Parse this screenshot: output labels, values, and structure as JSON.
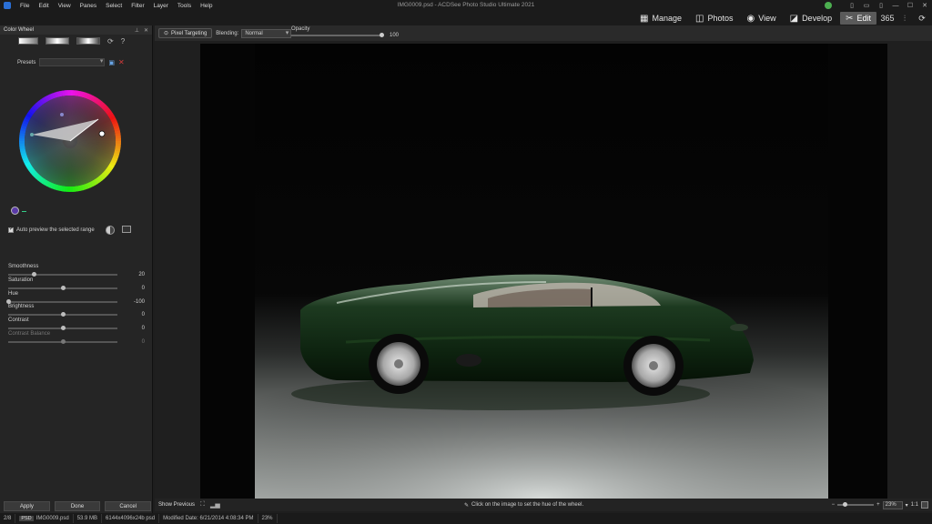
{
  "app": {
    "title": "IMG0009.psd - ACDSee Photo Studio Ultimate 2021",
    "menu": [
      "File",
      "Edit",
      "View",
      "Panes",
      "Select",
      "Filter",
      "Layer",
      "Tools",
      "Help"
    ]
  },
  "modes": [
    {
      "label": "Manage",
      "icon": "grid-icon"
    },
    {
      "label": "Photos",
      "icon": "photos-icon"
    },
    {
      "label": "View",
      "icon": "eye-icon"
    },
    {
      "label": "Develop",
      "icon": "develop-icon"
    },
    {
      "label": "Edit",
      "icon": "edit-icon",
      "active": true
    }
  ],
  "mode_extra_icons": [
    "365",
    "⫶",
    "⟳"
  ],
  "panel": {
    "title": "Color Wheel",
    "presets_label": "Presets",
    "auto_preview_label": "Auto preview the selected range",
    "sliders": [
      {
        "label": "Smoothness",
        "value": "20",
        "pos": 0.23,
        "disabled": false
      },
      {
        "label": "Saturation",
        "value": "0",
        "pos": 0.5,
        "disabled": false
      },
      {
        "label": "Hue",
        "value": "-100",
        "pos": 0.0,
        "disabled": false
      },
      {
        "label": "Brightness",
        "value": "0",
        "pos": 0.5,
        "disabled": false
      },
      {
        "label": "Contrast",
        "value": "0",
        "pos": 0.5,
        "disabled": false
      },
      {
        "label": "Contrast Balance",
        "value": "0",
        "pos": 0.5,
        "disabled": true
      }
    ],
    "buttons": {
      "apply": "Apply",
      "done": "Done",
      "cancel": "Cancel"
    }
  },
  "toolbar": {
    "pixel_targeting": "Pixel Targeting",
    "blending_label": "Blending:",
    "blending_value": "Normal",
    "opacity_label": "Opacity",
    "opacity_value": "100"
  },
  "footer": {
    "show_previous": "Show Previous",
    "hint": "Click on the image to set the hue of the wheel.",
    "zoom": "23%",
    "ratio": "1:1"
  },
  "status": {
    "index": "2/8",
    "format": "PSD",
    "filename": "IMG0009.psd",
    "size": "53.9 MB",
    "dimensions": "6144x4096x24b psd",
    "modified": "Modified Date: 6/21/2014 4:08:34 PM",
    "zoom": "23%"
  }
}
